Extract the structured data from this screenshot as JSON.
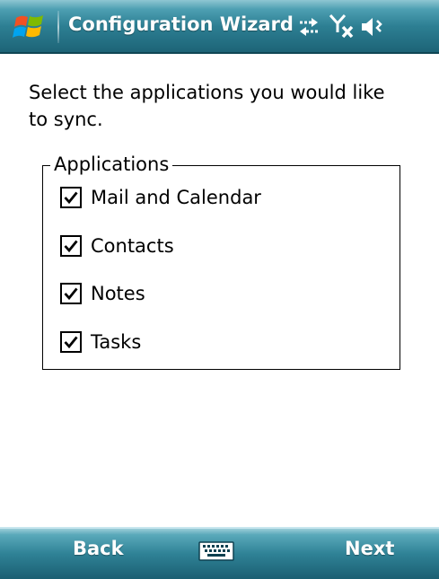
{
  "title_bar": {
    "title": "Configuration Wizard",
    "icons": [
      "windows-start-icon",
      "sync-arrows-icon",
      "no-signal-icon",
      "speaker-volume-icon"
    ]
  },
  "main": {
    "instructions": "Select the applications you would like to sync.",
    "group_label": "Applications",
    "applications": [
      {
        "label": "Mail and Calendar",
        "checked": true
      },
      {
        "label": "Contacts",
        "checked": true
      },
      {
        "label": "Notes",
        "checked": true
      },
      {
        "label": "Tasks",
        "checked": true
      }
    ]
  },
  "soft_keys": {
    "left_label": "Back",
    "right_label": "Next",
    "center_icon": "keyboard-icon"
  },
  "colors": {
    "bar_teal": "#2d7f93",
    "text": "#000000",
    "background": "#ffffff"
  }
}
